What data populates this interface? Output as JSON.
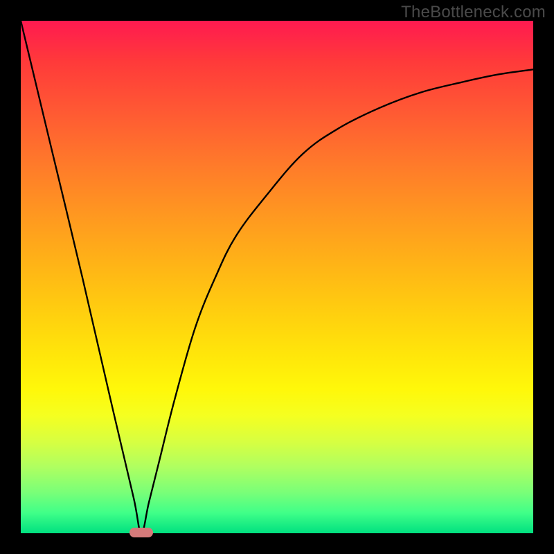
{
  "watermark": "TheBottleneck.com",
  "chart_data": {
    "type": "line",
    "title": "",
    "xlabel": "",
    "ylabel": "",
    "xlim": [
      0,
      100
    ],
    "ylim": [
      0,
      100
    ],
    "grid": false,
    "series": [
      {
        "name": "bottleneck-curve",
        "x": [
          0,
          6,
          12,
          18,
          22,
          23.5,
          25,
          27,
          30,
          34,
          38,
          42,
          48,
          55,
          62,
          70,
          78,
          86,
          93,
          100
        ],
        "values": [
          100,
          75,
          50,
          24,
          7,
          0,
          6,
          14,
          26,
          40,
          50,
          58,
          66,
          74,
          79,
          83,
          86,
          88,
          89.5,
          90.5
        ]
      }
    ],
    "markers": [
      {
        "name": "optimal-point",
        "x": 23.5,
        "y": 0,
        "shape": "pill",
        "color": "#d57a7a"
      }
    ],
    "gradient_colors": {
      "top": "#ff1a50",
      "mid_upper": "#ff7a2a",
      "mid": "#ffd20e",
      "mid_lower": "#fff80a",
      "bottom": "#00e080"
    }
  }
}
